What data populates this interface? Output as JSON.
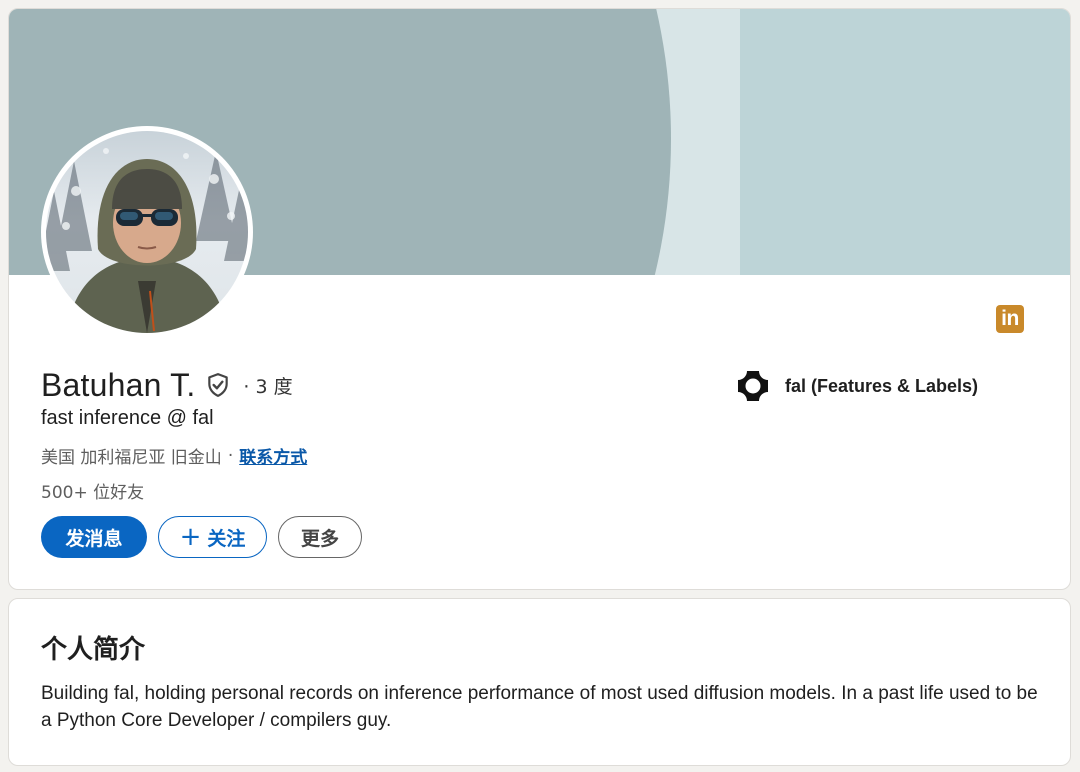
{
  "profile": {
    "name": "Batuhan T.",
    "degree": "· 3 度",
    "headline": "fast inference @ fal",
    "location": "美国 加利福尼亚 旧金山",
    "location_separator": "·",
    "contact_link": "联系方式",
    "connections": "500+ 位好友",
    "verified_icon": "shield-check-icon",
    "linkedin_badge": "in",
    "linkedin_badge_color": "#c9892a"
  },
  "actions": {
    "message_label": "发消息",
    "follow_icon": "+",
    "follow_label": "关注",
    "more_label": "更多",
    "primary_color": "#0a66c2"
  },
  "company": {
    "name": "fal (Features & Labels)",
    "logo_icon": "fal-logo-icon"
  },
  "banner": {
    "colors": [
      "#9fb4b7",
      "#d8e5e7",
      "#bdd4d7"
    ]
  },
  "about": {
    "title": "个人简介",
    "text": "Building fal, holding personal records on inference performance of most used diffusion models. In a past life used to be a Python Core Developer / compilers guy."
  }
}
